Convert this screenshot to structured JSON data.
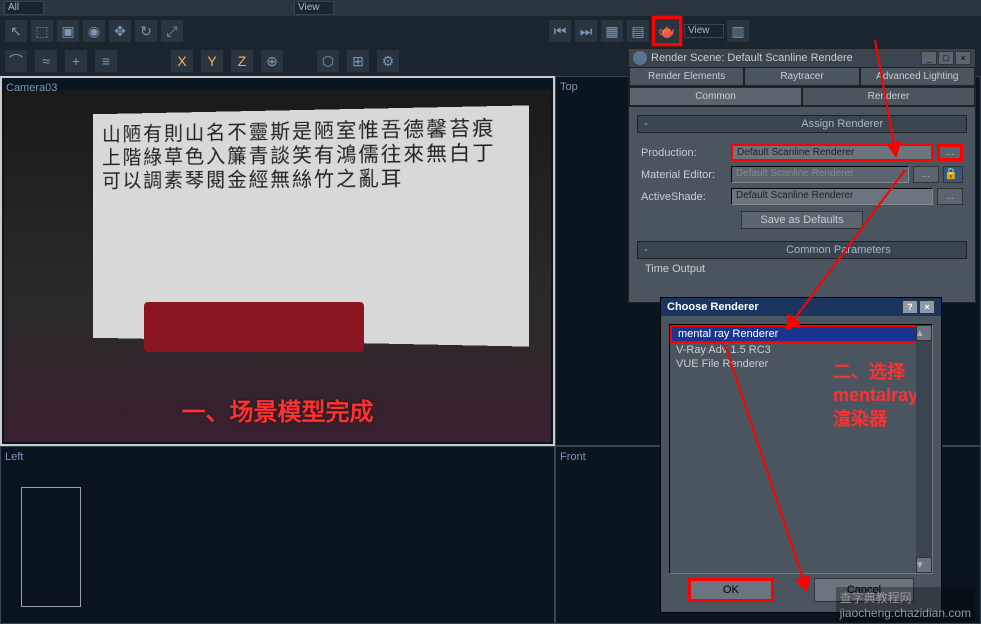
{
  "toolbar": {
    "all_label": "All",
    "view_label": "View"
  },
  "viewports": {
    "camera": "Camera03",
    "top": "Top",
    "left": "Left",
    "front": "Front"
  },
  "preview": {
    "calligraphy_text": "山陋有則山名不靈斯是陋室惟吾德馨苔痕上階綠草色入簾青談笑有鴻儒往來無白丁可以調素琴閱金經無絲竹之亂耳",
    "caption": "一、场景模型完成"
  },
  "render_dialog": {
    "title": "Render Scene: Default Scanline Rendere",
    "tabs": {
      "render_elements": "Render Elements",
      "raytracer": "Raytracer",
      "advanced_lighting": "Advanced Lighting",
      "common": "Common",
      "renderer": "Renderer"
    },
    "assign_renderer_header": "Assign Renderer",
    "production_label": "Production:",
    "production_value": "Default Scanline Renderer",
    "material_editor_label": "Material Editor:",
    "material_editor_value": "Default Scanline Renderer",
    "activeshade_label": "ActiveShade:",
    "activeshade_value": "Default Scanline Renderer",
    "save_defaults": "Save as Defaults",
    "common_params_header": "Common Parameters",
    "time_output_label": "Time Output"
  },
  "choose_renderer": {
    "title": "Choose Renderer",
    "items": {
      "mental_ray": "mental ray Renderer",
      "vray": "V-Ray Adv 1.5 RC3",
      "vue": "VUE File Renderer"
    },
    "annotation": "二、选择\nmentalray\n渲染器",
    "ok": "OK",
    "cancel": "Cancel"
  },
  "watermark": "查字典教程网\njiaocheng.chazidian.com"
}
